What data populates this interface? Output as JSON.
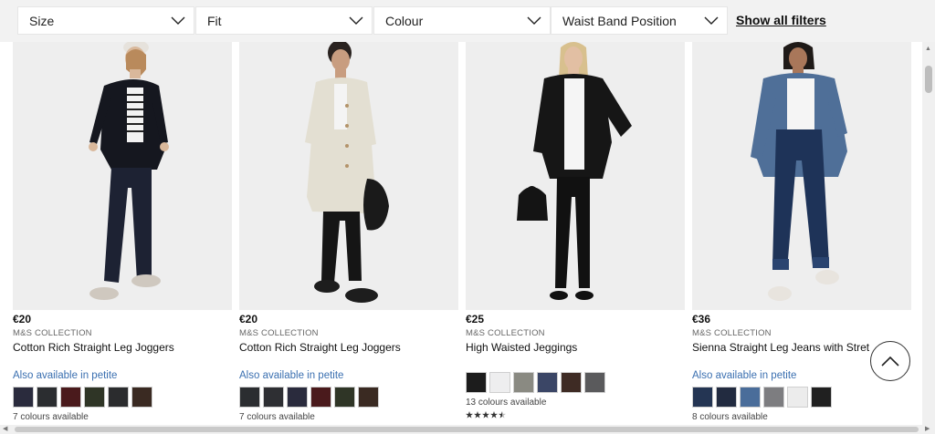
{
  "filters": {
    "size": "Size",
    "fit": "Fit",
    "colour": "Colour",
    "waist": "Waist Band Position",
    "show_all": "Show all filters"
  },
  "products": [
    {
      "price": "€20",
      "brand": "M&S COLLECTION",
      "title": "Cotton Rich Straight Leg Joggers",
      "petite": "Also available in petite",
      "swatches": [
        "#2a2b3d",
        "#2b2d30",
        "#4a1a1c",
        "#2f3526",
        "#2b2c2e",
        "#3a2a22"
      ],
      "colours": "7 colours available"
    },
    {
      "price": "€20",
      "brand": "M&S COLLECTION",
      "title": "Cotton Rich Straight Leg Joggers",
      "petite": "Also available in petite",
      "swatches": [
        "#2b2d30",
        "#2e2f33",
        "#2a2b3d",
        "#4a1a1c",
        "#2f3526",
        "#3a2a22"
      ],
      "colours": "7 colours available"
    },
    {
      "price": "€25",
      "brand": "M&S COLLECTION",
      "title": "High Waisted Jeggings",
      "swatches": [
        "#1c1c1c",
        "#eeeeef",
        "#8a8a82",
        "#3b4666",
        "#3e2b24",
        "#5a5a5c"
      ],
      "colours": "13 colours available",
      "rating": 4.5
    },
    {
      "price": "€36",
      "brand": "M&S COLLECTION",
      "title": "Sienna Straight Leg Jeans with Stret",
      "petite": "Also available in petite",
      "swatches": [
        "#243553",
        "#222b40",
        "#4a6d9a",
        "#7d7d80",
        "#ececec",
        "#202020"
      ],
      "colours": "8 colours available"
    }
  ],
  "icons": {
    "chevron": "chevron-down-icon",
    "scroll_top": "chevron-up-icon"
  }
}
